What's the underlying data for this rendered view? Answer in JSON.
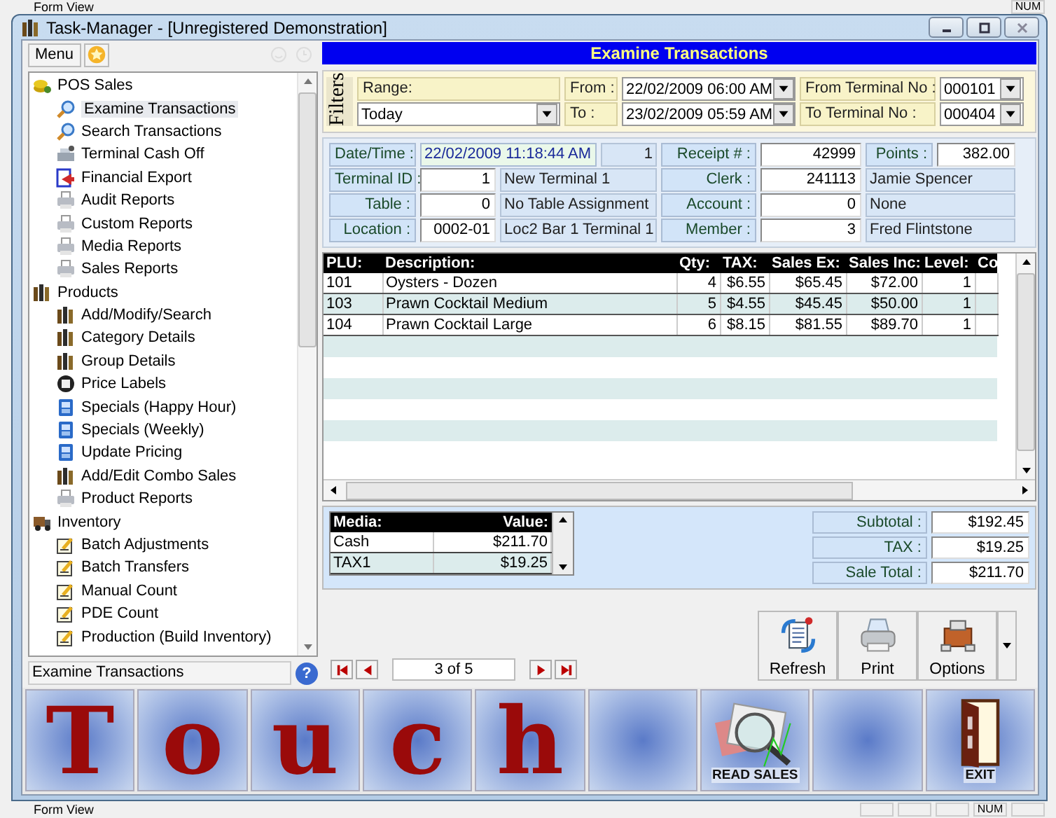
{
  "background_app": {
    "status_text": "Form View",
    "indicator": "NUM"
  },
  "window": {
    "title": "Task-Manager - [Unregistered Demonstration]"
  },
  "sidebar": {
    "menu_button": "Menu",
    "current": "Examine Transactions",
    "help_button": "?",
    "tree": [
      {
        "label": "POS Sales",
        "kind": "coins",
        "selected": false,
        "children": [
          {
            "label": "Examine Transactions",
            "kind": "magnifier",
            "selected": true
          },
          {
            "label": "Search Transactions",
            "kind": "magnifier",
            "selected": false
          },
          {
            "label": "Terminal Cash Off",
            "kind": "register",
            "selected": false
          },
          {
            "label": "Financial Export",
            "kind": "export",
            "selected": false
          },
          {
            "label": "Audit Reports",
            "kind": "printer",
            "selected": false
          },
          {
            "label": "Custom Reports",
            "kind": "printer",
            "selected": false
          },
          {
            "label": "Media Reports",
            "kind": "printer",
            "selected": false
          },
          {
            "label": "Sales Reports",
            "kind": "printer",
            "selected": false
          }
        ]
      },
      {
        "label": "Products",
        "kind": "shelves",
        "selected": false,
        "children": [
          {
            "label": "Add/Modify/Search",
            "kind": "shelves",
            "selected": false
          },
          {
            "label": "Category Details",
            "kind": "shelves",
            "selected": false
          },
          {
            "label": "Group Details",
            "kind": "shelves",
            "selected": false
          },
          {
            "label": "Price Labels",
            "kind": "tag",
            "selected": false
          },
          {
            "label": "Specials (Happy Hour)",
            "kind": "document",
            "selected": false
          },
          {
            "label": "Specials (Weekly)",
            "kind": "document",
            "selected": false
          },
          {
            "label": "Update Pricing",
            "kind": "document",
            "selected": false
          },
          {
            "label": "Add/Edit Combo Sales",
            "kind": "shelves",
            "selected": false
          },
          {
            "label": "Product Reports",
            "kind": "printer",
            "selected": false
          }
        ]
      },
      {
        "label": "Inventory",
        "kind": "truck",
        "selected": false,
        "children": [
          {
            "label": "Batch Adjustments",
            "kind": "clipboard",
            "selected": false
          },
          {
            "label": "Batch Transfers",
            "kind": "clipboard",
            "selected": false
          },
          {
            "label": "Manual Count",
            "kind": "clipboard",
            "selected": false
          },
          {
            "label": "PDE Count",
            "kind": "clipboard",
            "selected": false
          },
          {
            "label": "Production (Build Inventory)",
            "kind": "clipboard",
            "selected": false
          }
        ]
      }
    ]
  },
  "panel": {
    "title": "Examine Transactions",
    "filters": {
      "heading": "Filters",
      "range_label": "Range:",
      "range_value": "Today",
      "from_label": "From :",
      "from_value": "22/02/2009 06:00 AM",
      "to_label": "To :",
      "to_value": "23/02/2009 05:59 AM",
      "from_terminal_label": "From Terminal No :",
      "from_terminal_value": "000101",
      "to_terminal_label": "To Terminal No :",
      "to_terminal_value": "000404"
    },
    "details": [
      {
        "kind": "date",
        "label": "Date/Time :",
        "value": "22/02/2009 11:18:44 AM",
        "note": "1",
        "mid_label": "Receipt # :",
        "mid_value": "42999",
        "right_label": "Points :",
        "right_value": "382.00"
      },
      {
        "kind": "number",
        "label": "Terminal ID :",
        "value": "1",
        "note": "New Terminal 1",
        "mid_label": "Clerk :",
        "mid_value": "241113",
        "right_note": "Jamie Spencer"
      },
      {
        "kind": "number",
        "label": "Table :",
        "value": "0",
        "note": "No Table Assignment",
        "mid_label": "Account :",
        "mid_value": "0",
        "right_note": "None"
      },
      {
        "kind": "number",
        "label": "Location :",
        "value": "0002-01",
        "note": "Loc2 Bar 1 Terminal 1",
        "mid_label": "Member :",
        "mid_value": "3",
        "right_note": "Fred Flintstone"
      }
    ],
    "items_table": {
      "columns": [
        "PLU:",
        "Description:",
        "Qty:",
        "TAX:",
        "Sales Ex:",
        "Sales Inc:",
        "Level:",
        "Co"
      ],
      "rows": [
        [
          "101",
          "Oysters - Dozen",
          "4",
          "$6.55",
          "$65.45",
          "$72.00",
          "1"
        ],
        [
          "103",
          "Prawn Cocktail Medium",
          "5",
          "$4.55",
          "$45.45",
          "$50.00",
          "1"
        ],
        [
          "104",
          "Prawn Cocktail Large",
          "6",
          "$8.15",
          "$81.55",
          "$89.70",
          "1"
        ]
      ]
    },
    "media_table": {
      "columns": [
        "Media:",
        "Value:"
      ],
      "rows": [
        [
          "Cash",
          "$211.70"
        ],
        [
          "TAX1",
          "$19.25"
        ]
      ]
    },
    "totals": [
      {
        "label": "Subtotal :",
        "value": "$192.45"
      },
      {
        "label": "TAX :",
        "value": "$19.25"
      },
      {
        "label": "Sale Total :",
        "value": "$211.70"
      }
    ],
    "pager": {
      "position": "3 of 5"
    },
    "actions": [
      {
        "label": "Refresh",
        "kind": "refresh"
      },
      {
        "label": "Print",
        "kind": "printer"
      },
      {
        "label": "Options",
        "kind": "toolbox"
      }
    ]
  },
  "touch_bar": [
    {
      "kind": "letter",
      "text": "T"
    },
    {
      "kind": "letter",
      "text": "o"
    },
    {
      "kind": "letter",
      "text": "u"
    },
    {
      "kind": "letter",
      "text": "c"
    },
    {
      "kind": "letter",
      "text": "h"
    },
    {
      "kind": "blank"
    },
    {
      "kind": "report",
      "caption": "READ SALES"
    },
    {
      "kind": "blank"
    },
    {
      "kind": "exit",
      "caption": "EXIT"
    }
  ],
  "status_bar": {
    "text": "Form View",
    "indicator": "NUM"
  }
}
